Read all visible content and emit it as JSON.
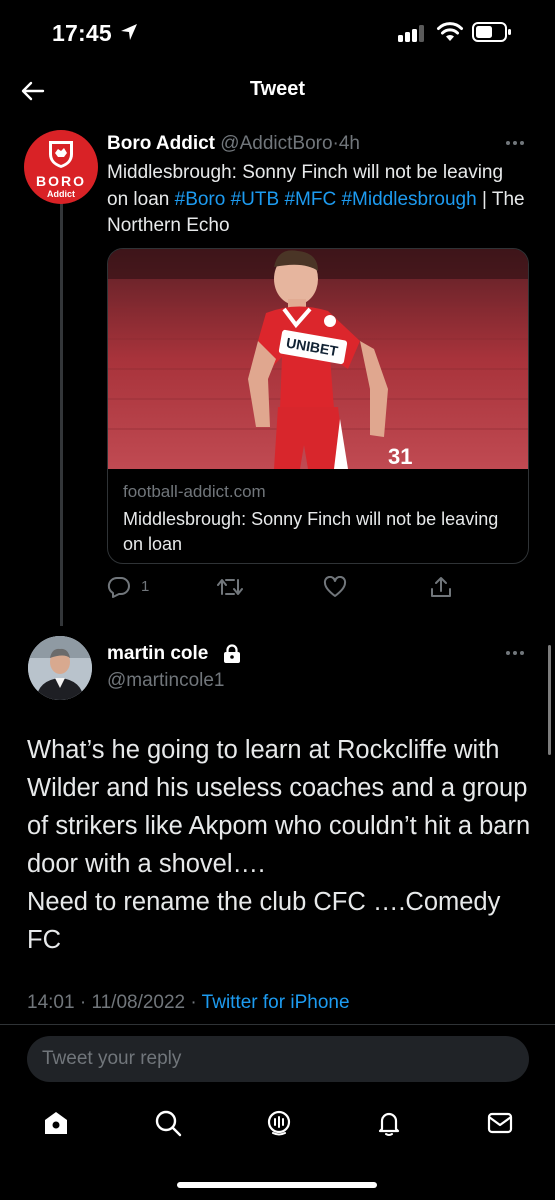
{
  "status_bar": {
    "time": "17:45"
  },
  "header": {
    "title": "Tweet"
  },
  "quoted_tweet": {
    "avatar": {
      "line1": "BORO",
      "line2": "Addict"
    },
    "author_name": "Boro Addict",
    "author_handle": "@AddictBoro",
    "separator": "·",
    "time_ago": "4h",
    "text_plain": "Middlesbrough: Sonny Finch will not be leaving on loan",
    "hashtags": [
      "#Boro",
      "#UTB",
      "#MFC",
      "#Middlesbrough"
    ],
    "text_suffix": "| The Northern Echo",
    "card": {
      "domain": "football-addict.com",
      "title": "Middlesbrough: Sonny Finch will not be leaving on loan",
      "image_shirt_sponsor": "UNIBET",
      "image_shirt_number": "31"
    },
    "reply_count": "1"
  },
  "reply_tweet": {
    "author_name": "martin cole",
    "author_handle": "@martincole1",
    "text": "What’s he going to learn at Rockcliffe with Wilder and his useless coaches and a group of strikers like Akpom who couldn’t hit a barn door with a shovel….\nNeed to rename the club CFC ….Comedy FC",
    "time": "14:01",
    "separator": "·",
    "date": "11/08/2022",
    "source": "Twitter for iPhone"
  },
  "reply_box": {
    "placeholder": "Tweet your reply"
  },
  "colors": {
    "accent": "#1d9bf0",
    "background": "#000000",
    "muted": "#71767b",
    "boro_red": "#d92226"
  }
}
